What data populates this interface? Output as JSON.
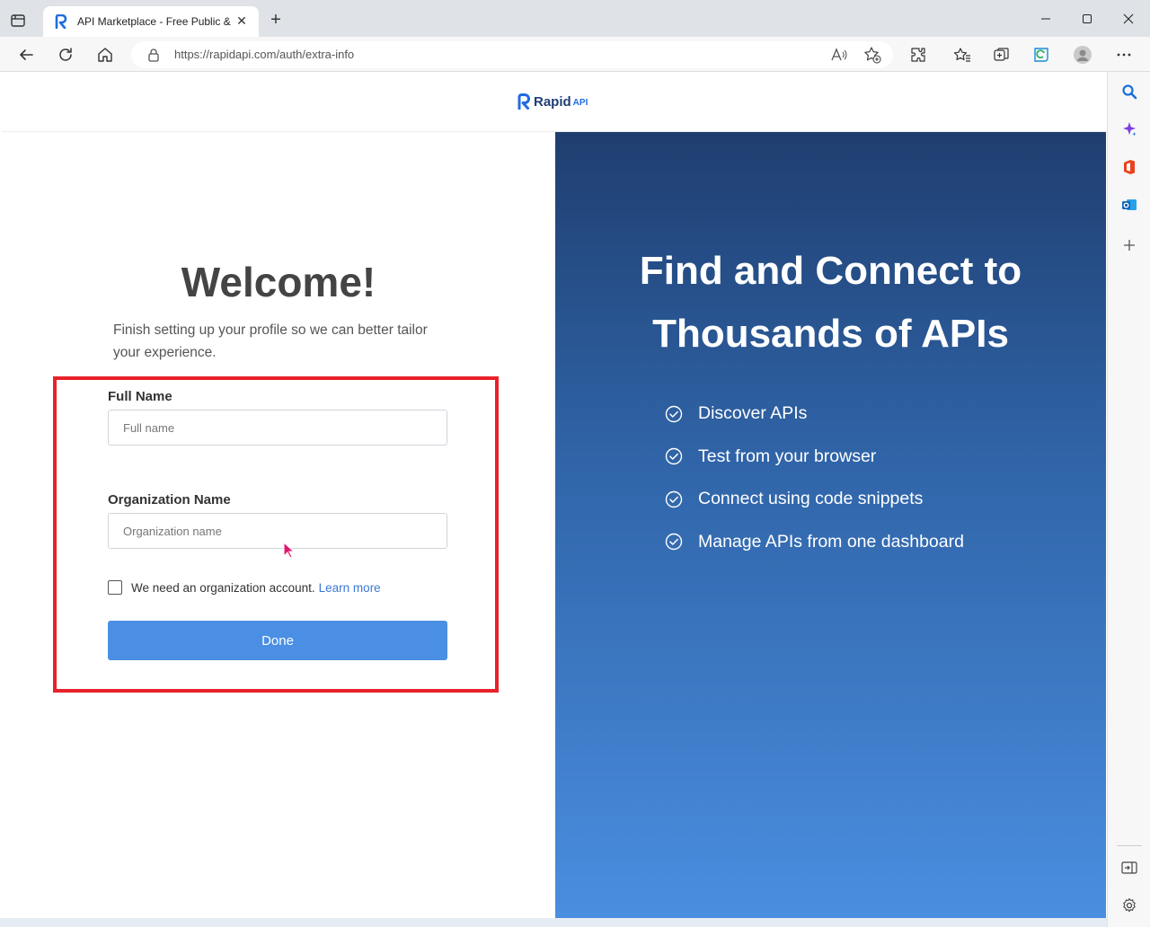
{
  "browser": {
    "tab_title": "API Marketplace - Free Public & Open Source APIs",
    "url": "https://rapidapi.com/auth/extra-info"
  },
  "header": {
    "logo_text": "Rapid",
    "logo_suffix": "API"
  },
  "form": {
    "heading": "Welcome!",
    "subtitle": "Finish setting up your profile so we can better tailor your experience.",
    "full_name_label": "Full Name",
    "full_name_value": "",
    "full_name_placeholder": "Full name",
    "org_name_label": "Organization Name",
    "org_name_value": "",
    "org_name_placeholder": "Organization name",
    "org_checkbox_label": "We need an organization account.",
    "org_checkbox_checked": false,
    "learn_more": "Learn more",
    "done_label": "Done"
  },
  "hero": {
    "title": "Find and Connect to Thousands of APIs",
    "features": [
      "Discover APIs",
      "Test from your browser",
      "Connect using code snippets",
      "Manage APIs from one dashboard"
    ]
  },
  "colors": {
    "brand": "#1f6de0",
    "button": "#4a8fe3",
    "highlight": "#e8212a",
    "hero_top": "#1f3e6f",
    "hero_bottom": "#4a8ee0"
  }
}
